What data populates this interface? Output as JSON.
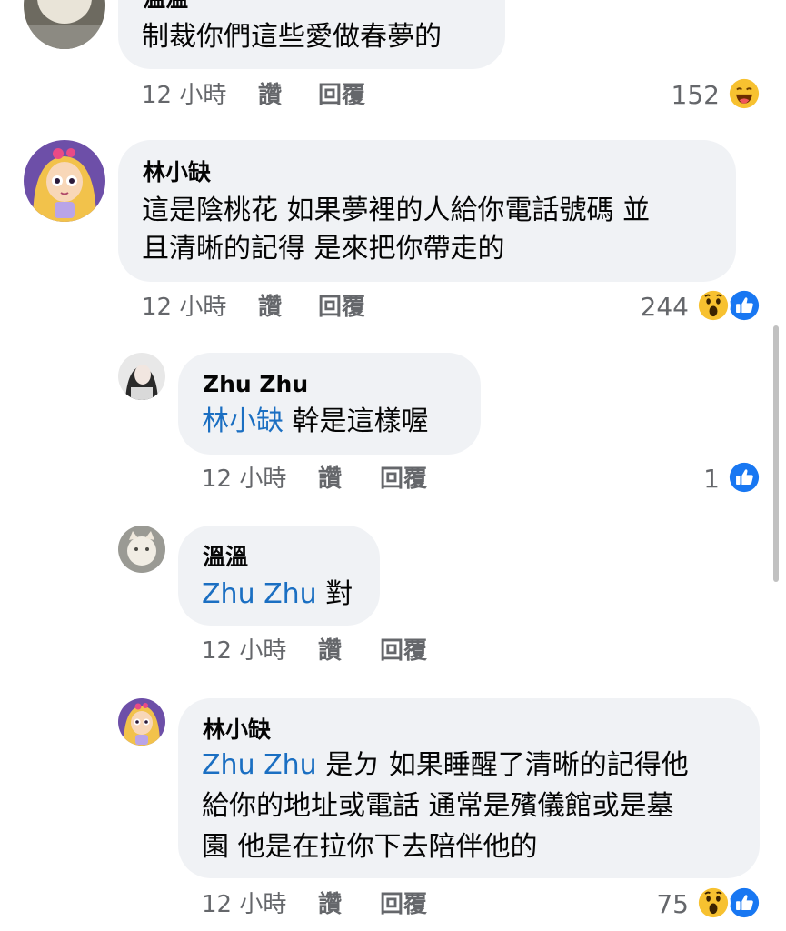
{
  "comments": [
    {
      "author": "溫溫",
      "text_lines": [
        "制裁你們這些愛做春夢的"
      ],
      "time": "12 小時",
      "like_label": "讚",
      "reply_label": "回覆",
      "reaction_count": "152",
      "reactions": [
        "haha-icon"
      ]
    },
    {
      "author": "林小缺",
      "text_lines": [
        "這是陰桃花 如果夢裡的人給你電話號碼 並",
        "且清晰的記得 是來把你帶走的"
      ],
      "time": "12 小時",
      "like_label": "讚",
      "reply_label": "回覆",
      "reaction_count": "244",
      "reactions": [
        "wow-icon",
        "like-icon"
      ]
    },
    {
      "author": "Zhu Zhu",
      "mention": "林小缺",
      "text_lines": [
        " 幹是這樣喔"
      ],
      "time": "12 小時",
      "like_label": "讚",
      "reply_label": "回覆",
      "reaction_count": "1",
      "reactions": [
        "like-icon"
      ]
    },
    {
      "author": "溫溫",
      "mention": "Zhu Zhu",
      "text_lines": [
        " 對"
      ],
      "time": "12 小時",
      "like_label": "讚",
      "reply_label": "回覆"
    },
    {
      "author": "林小缺",
      "mention": "Zhu Zhu",
      "text_lines": [
        " 是ㄉ 如果睡醒了清晰的記得他",
        "給你的地址或電話 通常是殯儀館或是墓",
        "園 他是在拉你下去陪伴他的"
      ],
      "time": "12 小時",
      "like_label": "讚",
      "reply_label": "回覆",
      "reaction_count": "75",
      "reactions": [
        "wow-icon",
        "like-icon"
      ]
    }
  ],
  "colors": {
    "bubble": "#f0f2f5",
    "mention": "#1b6fc2",
    "meta": "#65676b",
    "like_blue": "#1877f2"
  }
}
